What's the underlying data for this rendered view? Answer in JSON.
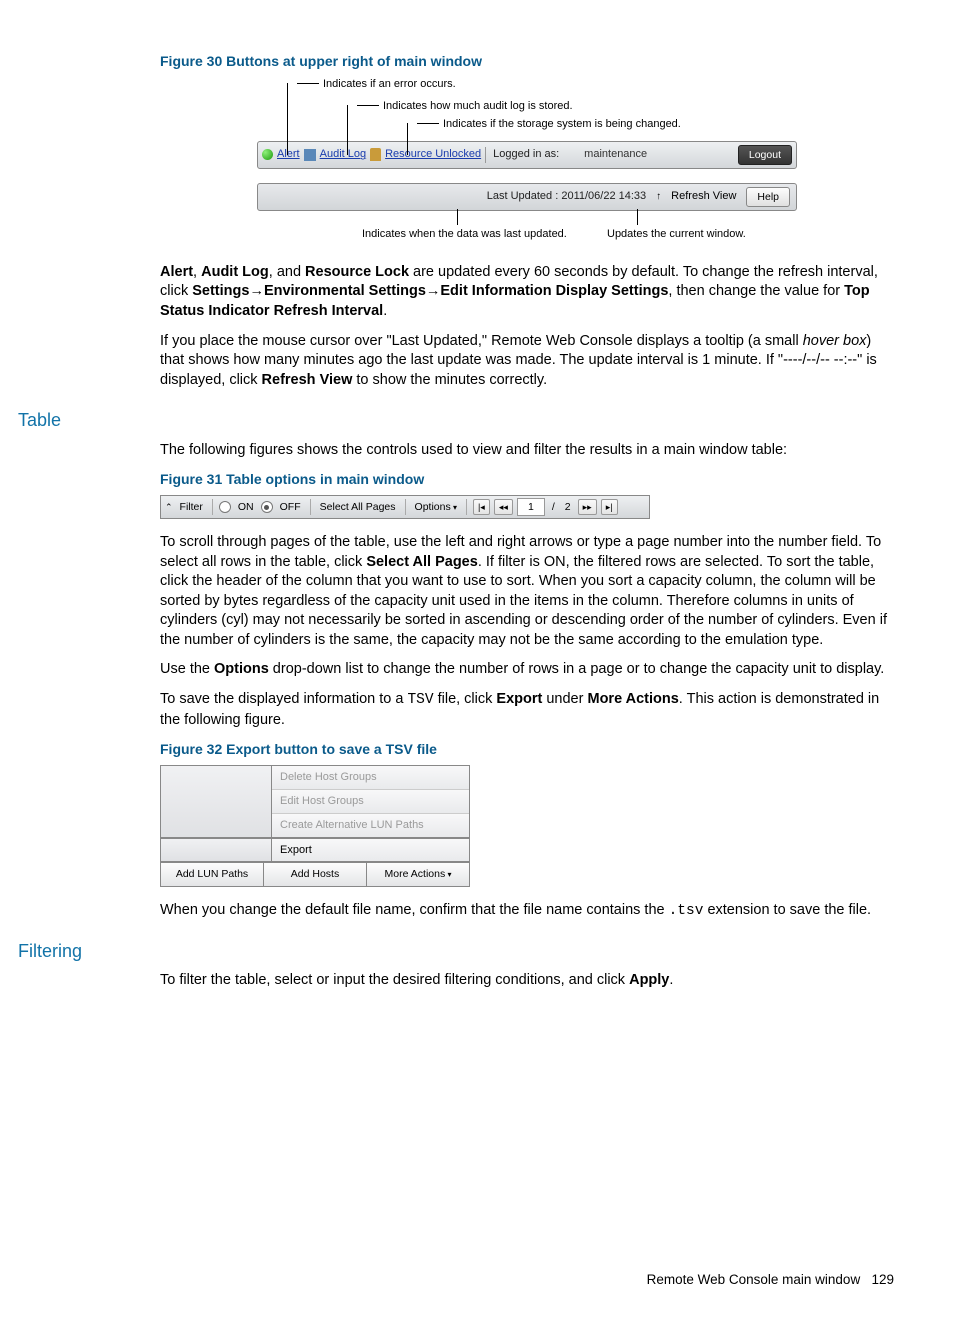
{
  "fig30": {
    "title": "Figure 30 Buttons at upper right of main window",
    "callout_error": "Indicates if an error occurs.",
    "callout_audit": "Indicates how much audit log is stored.",
    "callout_changing": "Indicates if the storage system is being changed.",
    "toolbar": {
      "alert": "Alert",
      "audit": "Audit Log",
      "resource": "Resource Unlocked",
      "logged_in": "Logged in as:",
      "user": "maintenance",
      "logout": "Logout"
    },
    "statusbar": {
      "last_updated": "Last Updated : 2011/06/22 14:33",
      "refresh": "Refresh View",
      "help": "Help"
    },
    "callout_updated": "Indicates when the data was last updated.",
    "callout_updates_window": "Updates the current window."
  },
  "para1_a": "Alert",
  "para1_b": ", ",
  "para1_c": "Audit Log",
  "para1_d": ", and ",
  "para1_e": "Resource Lock",
  "para1_f": " are updated every 60 seconds by default. To change the refresh interval, click ",
  "para1_g": "Settings",
  "para1_h": "→",
  "para1_i": "Environmental Settings",
  "para1_j": "→",
  "para1_k": "Edit Information Display Settings",
  "para1_l": ", then change the value for ",
  "para1_m": "Top Status Indicator Refresh Interval",
  "para1_n": ".",
  "para2_a": "If you place the mouse cursor over \"Last Updated,\" Remote Web Console displays a tooltip (a small ",
  "para2_b": "hover box",
  "para2_c": ") that shows how many minutes ago the last update was made. The update interval is 1 minute. If \"----/--/-- --:--\" is displayed, click ",
  "para2_d": "Refresh View",
  "para2_e": " to show the minutes correctly.",
  "section_table": "Table",
  "para3": "The following figures shows the controls used to view and filter the results in a main window table:",
  "fig31": {
    "title": "Figure 31  Table options in main window",
    "filter": "Filter",
    "on": "ON",
    "off": "OFF",
    "select_all": "Select All Pages",
    "options": "Options",
    "page_cur": "1",
    "page_sep": "/",
    "page_total": "2"
  },
  "para4_a": "To scroll through pages of the table, use the left and right arrows or type a page number into the number field. To select all rows in the table, click ",
  "para4_b": "Select All Pages",
  "para4_c": ". If filter is ON, the filtered rows are selected. To sort the table, click the header of the column that you want to use to sort. When you sort a capacity column, the column will be sorted by bytes regardless of the capacity unit used in the items in the column. Therefore columns in units of cylinders (cyl) may not necessarily be sorted in ascending or descending order of the number of cylinders. Even if the number of cylinders is the same, the capacity may not be the same according to the emulation type.",
  "para5_a": "Use the ",
  "para5_b": "Options",
  "para5_c": " drop-down list to change the number of rows in a page or to change the capacity unit to display.",
  "para6_a": "To save the displayed information to a ",
  "para6_b": "TSV",
  "para6_c": " file, click ",
  "para6_d": "Export",
  "para6_e": " under ",
  "para6_f": "More Actions",
  "para6_g": ". This action is demonstrated in the following figure.",
  "fig32": {
    "title": "Figure 32 Export button to save a TSV file",
    "menu1": "Delete Host Groups",
    "menu2": "Edit Host Groups",
    "menu3": "Create Alternative LUN Paths",
    "menu_export": "Export",
    "btn1": "Add LUN Paths",
    "btn2": "Add Hosts",
    "btn3": "More Actions"
  },
  "para7_a": "When you change the default file name, confirm that the file name contains the ",
  "para7_b": ".tsv",
  "para7_c": " extension to save the file.",
  "section_filtering": "Filtering",
  "para8_a": "To filter the table, select or input the desired filtering conditions, and click ",
  "para8_b": "Apply",
  "para8_c": ".",
  "footer_text": "Remote Web Console main window",
  "footer_page": "129"
}
